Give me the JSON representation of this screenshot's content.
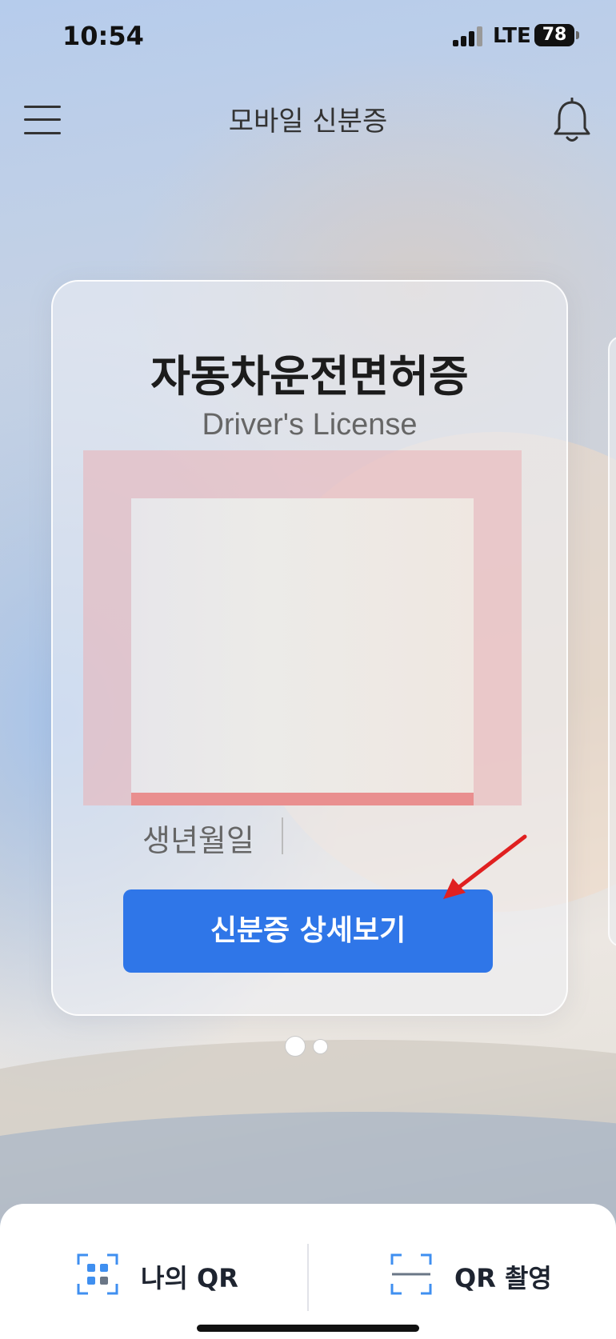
{
  "status_bar": {
    "time": "10:54",
    "network": "LTE",
    "battery": "78"
  },
  "header": {
    "title": "모바일 신분증",
    "menu_icon": "hamburger-menu-icon",
    "notification_icon": "bell-icon"
  },
  "card": {
    "title": "자동차운전면허증",
    "subtitle": "Driver's License",
    "birth_label": "생년월일",
    "detail_button": "신분증 상세보기"
  },
  "pager": {
    "total": 2,
    "active": 1
  },
  "bottom_bar": {
    "tabs": [
      {
        "label": "나의 QR",
        "icon": "qr-code-icon"
      },
      {
        "label": "QR 촬영",
        "icon": "qr-scan-icon"
      }
    ]
  },
  "colors": {
    "accent": "#2f76e8",
    "annotation_arrow": "#e02020"
  }
}
